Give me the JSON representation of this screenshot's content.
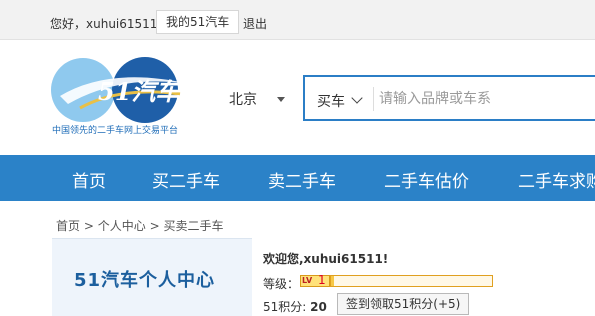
{
  "topbar": {
    "greeting": "您好，xuhui61511",
    "my51_label": "我的51汽车",
    "logout_label": "退出"
  },
  "logo": {
    "wordmark": "51汽车",
    "tagline": "中国领先的二手车网上交易平台"
  },
  "header": {
    "city": "北京",
    "search": {
      "type_label": "买车",
      "placeholder": "请输入品牌或车系"
    }
  },
  "nav": {
    "items": [
      {
        "label": "首页"
      },
      {
        "label": "买二手车"
      },
      {
        "label": "卖二手车"
      },
      {
        "label": "二手车估价"
      },
      {
        "label": "二手车求购"
      }
    ]
  },
  "breadcrumb": {
    "items": [
      "首页",
      "个人中心",
      "买卖二手车"
    ],
    "separator": ">"
  },
  "panel": {
    "title": "51汽车个人中心",
    "welcome": "欢迎您,xuhui61511!",
    "level_label": "等级：",
    "level_badge": "LV",
    "level_number": "1",
    "level_progress": 0.02,
    "points_label": "51积分:",
    "points_value": "20",
    "sign_in_label": "签到领取51积分(+5)"
  },
  "colors": {
    "brand_blue": "#2b82c8",
    "panel_title": "#1c5f9e",
    "level_gold": "#f7c845"
  }
}
